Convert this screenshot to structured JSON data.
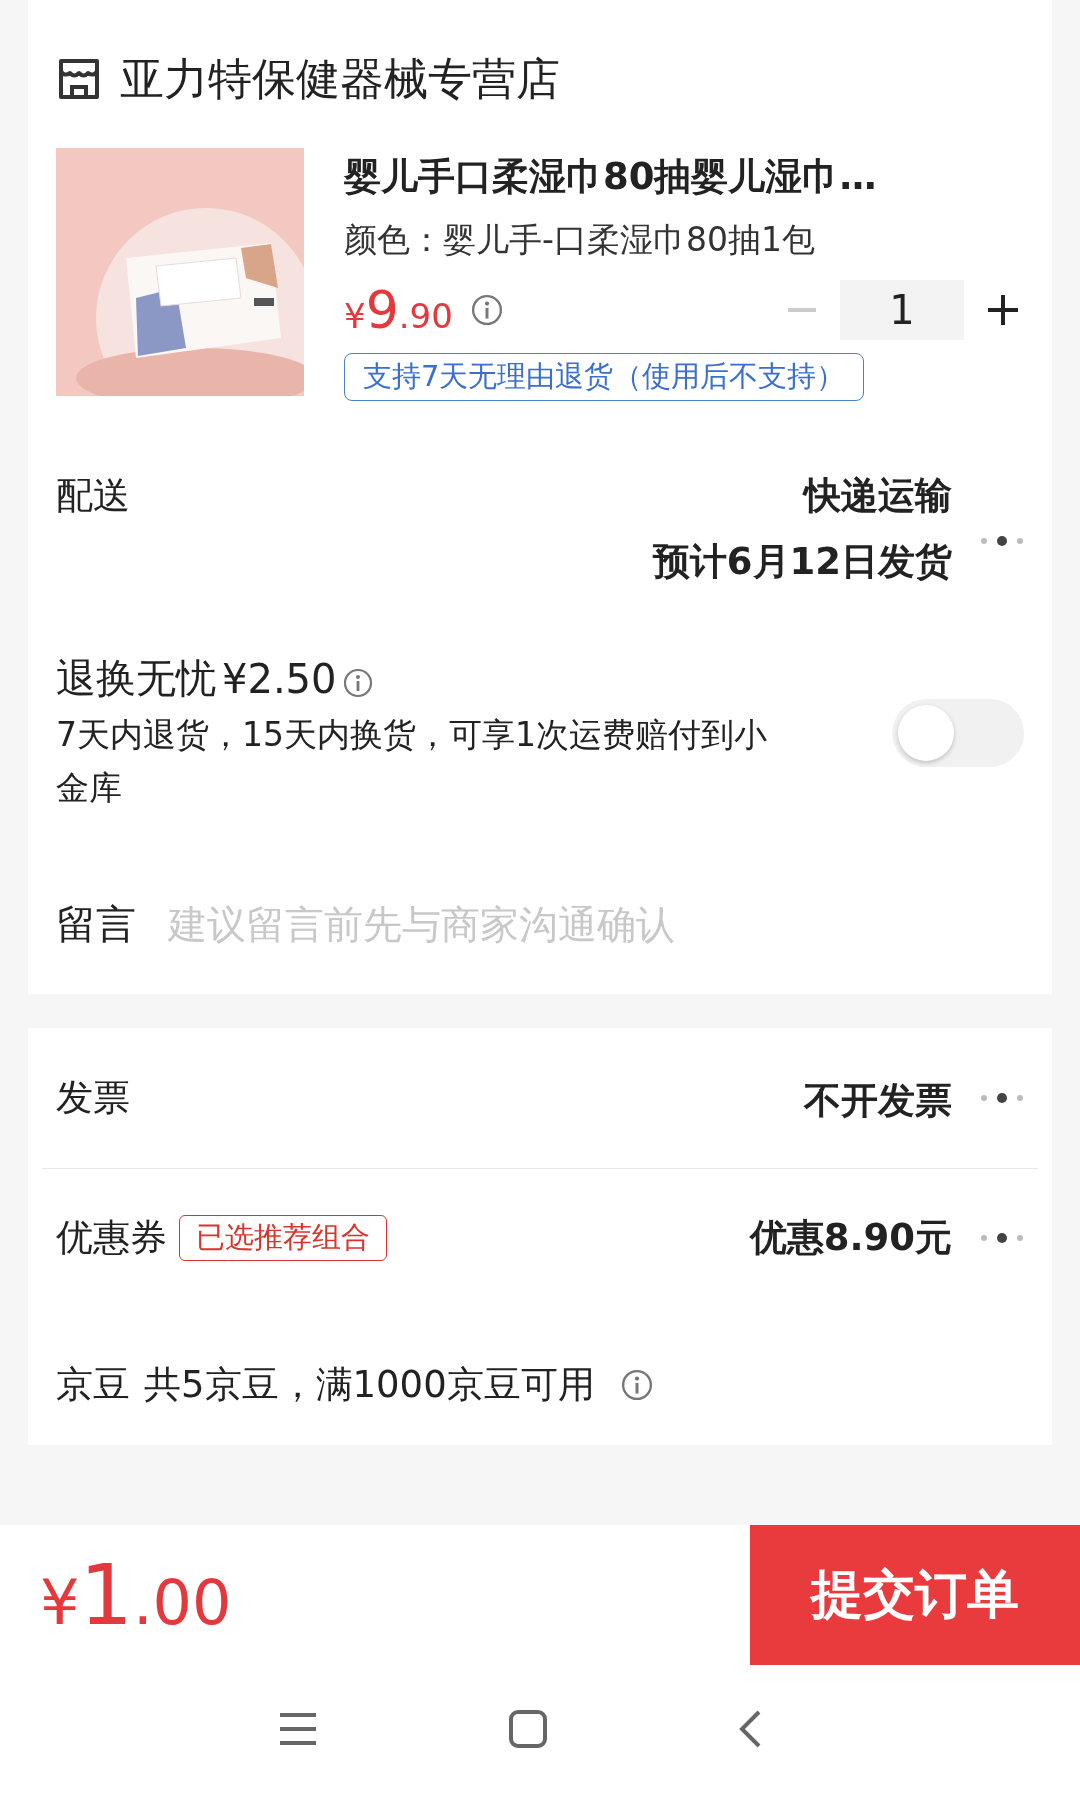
{
  "store": {
    "name": "亚力特保健器械专营店"
  },
  "product": {
    "title": "婴儿手口柔湿巾80抽婴儿湿巾…",
    "variant": "颜色：婴儿手-口柔湿巾80抽1包",
    "price": {
      "currency": "¥",
      "integer": "9",
      "decimal": ".90"
    },
    "quantity": "1",
    "minus_disabled": true,
    "return_policy": "支持7天无理由退货（使用后不支持）"
  },
  "delivery": {
    "label": "配送",
    "method": "快递运输",
    "estimate": "预计6月12日发货"
  },
  "return_insurance": {
    "title": "退换无忧",
    "price": "¥2.50",
    "description": "7天内退货，15天内换货，可享1次运费赔付到小金库",
    "on": false
  },
  "message": {
    "label": "留言",
    "placeholder": "建议留言前先与商家沟通确认"
  },
  "invoice": {
    "label": "发票",
    "value": "不开发票"
  },
  "coupon": {
    "label": "优惠券",
    "tag": "已选推荐组合",
    "value": "优惠8.90元"
  },
  "beans": {
    "label": "京豆",
    "text": "共5京豆，满1000京豆可用"
  },
  "footer": {
    "total": {
      "currency": "¥",
      "integer": "1",
      "decimal": ".00"
    },
    "submit": "提交订单"
  }
}
